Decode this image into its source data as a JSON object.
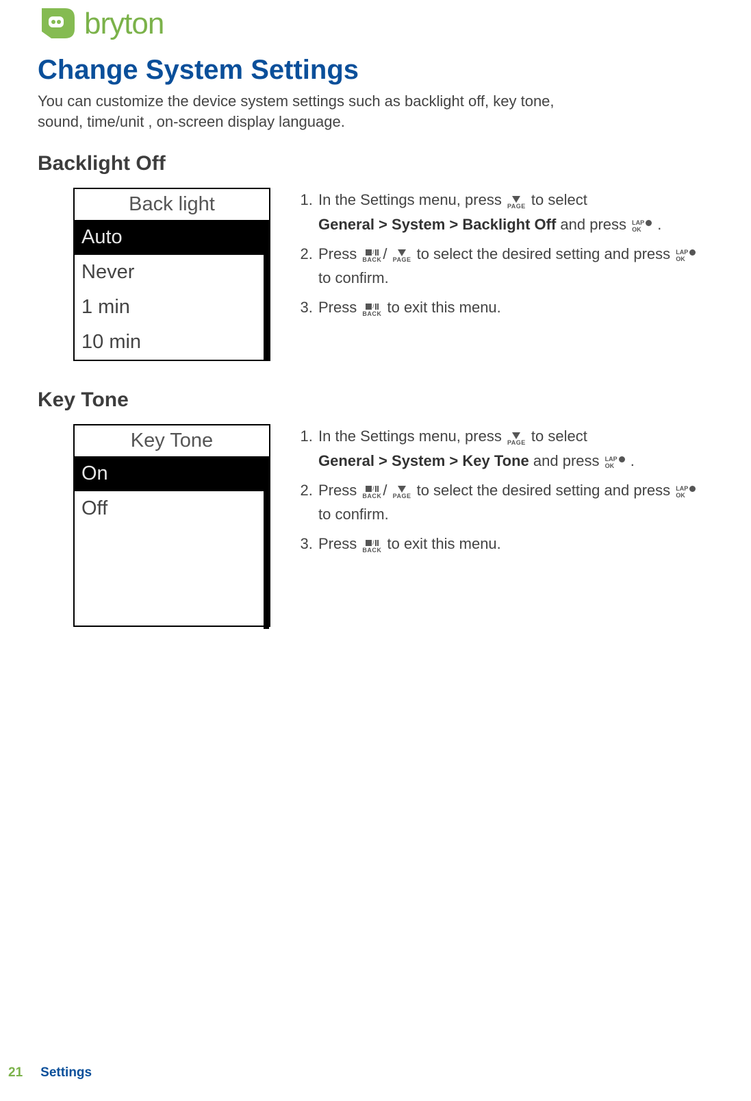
{
  "brand": "bryton",
  "title": "Change System Settings",
  "intro": "You can customize the device system settings such as backlight off, key tone, sound, time/unit , on-screen display language.",
  "sections": {
    "backlight": {
      "heading": "Backlight Off",
      "screen": {
        "title": "Back light",
        "items": [
          "Auto",
          "Never",
          "1 min",
          "10 min"
        ],
        "selected": 0
      },
      "path": [
        "General",
        "System",
        "Backlight Off"
      ],
      "steps": {
        "s1a": "In the Settings menu, press ",
        "s1b": " to select",
        "s1c": " and press ",
        "s1d": ".",
        "s2a": "Press ",
        "s2b": " to select the desired setting and press ",
        "s2c": " to confirm.",
        "s3a": "Press ",
        "s3b": " to exit this menu."
      }
    },
    "keytone": {
      "heading": "Key Tone",
      "screen": {
        "title": "Key Tone",
        "items": [
          "On",
          "Off"
        ],
        "selected": 0
      },
      "path": [
        "General",
        "System",
        "Key Tone"
      ],
      "steps": {
        "s1a": "In the Settings menu, press ",
        "s1b": " to select",
        "s1c": " and press ",
        "s1d": ".",
        "s2a": "Press ",
        "s2b": " to select the desired setting and press ",
        "s2c": " to confirm.",
        "s3a": "Press ",
        "s3b": " to exit this menu."
      }
    }
  },
  "icons": {
    "page": {
      "label": "PAGE"
    },
    "back": {
      "label": "BACK"
    },
    "lapok": {
      "top": "LAP",
      "bottom": "OK"
    }
  },
  "misc": {
    "slash": "/",
    "gt": " > "
  },
  "footer": {
    "page": "21",
    "section": "Settings"
  }
}
